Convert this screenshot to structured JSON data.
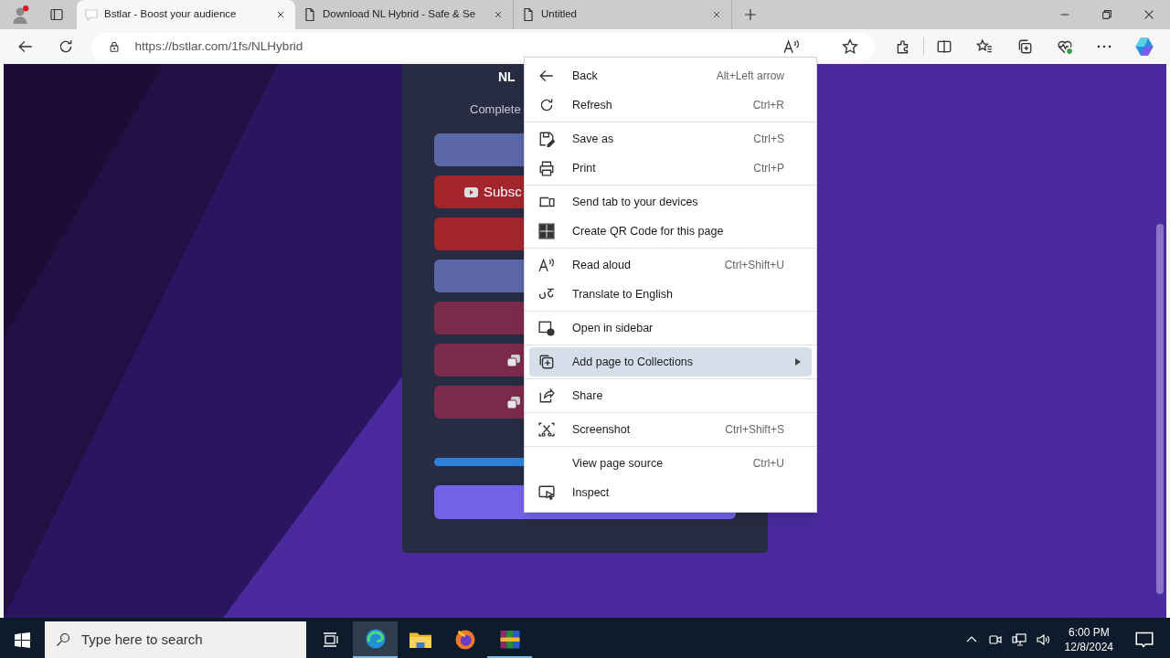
{
  "browser": {
    "tabs": [
      {
        "title": "Bstlar - Boost your audience",
        "selected": true
      },
      {
        "title": "Download NL Hybrid - Safe & Se",
        "selected": false
      },
      {
        "title": "Untitled",
        "selected": false
      }
    ],
    "address": "https://bstlar.com/1fs/NLHybrid"
  },
  "page": {
    "title": "NL",
    "subtitle": "Complete",
    "buttons": [
      {
        "kind": "plain",
        "color": "#5b67a6"
      },
      {
        "kind": "subscribe",
        "color": "#a3262d",
        "label": "Subsc"
      },
      {
        "kind": "plain",
        "color": "#a3262d"
      },
      {
        "kind": "plain",
        "color": "#5b67a6"
      },
      {
        "kind": "plain",
        "color": "#7b2a4c"
      },
      {
        "kind": "copy",
        "color": "#7b2a4c"
      },
      {
        "kind": "copy",
        "color": "#7b2a4c"
      }
    ]
  },
  "context_menu": {
    "groups": [
      [
        {
          "label": "Back",
          "shortcut": "Alt+Left arrow",
          "selected": false,
          "has_submenu": false
        },
        {
          "label": "Refresh",
          "shortcut": "Ctrl+R",
          "selected": false,
          "has_submenu": false
        }
      ],
      [
        {
          "label": "Save as",
          "shortcut": "Ctrl+S",
          "selected": false,
          "has_submenu": false
        },
        {
          "label": "Print",
          "shortcut": "Ctrl+P",
          "selected": false,
          "has_submenu": false
        }
      ],
      [
        {
          "label": "Send tab to your devices",
          "selected": false,
          "has_submenu": false
        },
        {
          "label": "Create QR Code for this page",
          "selected": false,
          "has_submenu": false
        }
      ],
      [
        {
          "label": "Read aloud",
          "shortcut": "Ctrl+Shift+U",
          "selected": false,
          "has_submenu": false
        },
        {
          "label": "Translate to English",
          "selected": false,
          "has_submenu": false
        }
      ],
      [
        {
          "label": "Open in sidebar",
          "selected": false,
          "has_submenu": false
        }
      ],
      [
        {
          "label": "Add page to Collections",
          "selected": true,
          "has_submenu": true
        }
      ],
      [
        {
          "label": "Share",
          "selected": false,
          "has_submenu": false
        }
      ],
      [
        {
          "label": "Screenshot",
          "shortcut": "Ctrl+Shift+S",
          "selected": false,
          "has_submenu": false
        }
      ],
      [
        {
          "label": "View page source",
          "shortcut": "Ctrl+U",
          "selected": false,
          "has_submenu": false
        },
        {
          "label": "Inspect",
          "selected": false,
          "has_submenu": false
        }
      ]
    ]
  },
  "taskbar": {
    "search_placeholder": "Type here to search",
    "time": "6:00 PM",
    "date": "12/8/2024"
  }
}
